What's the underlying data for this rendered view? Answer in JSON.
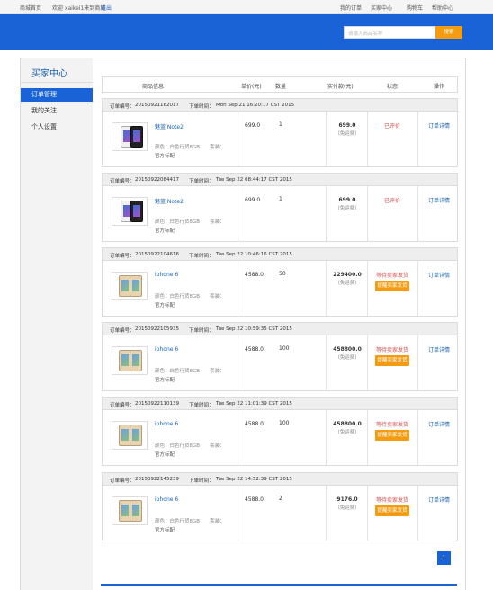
{
  "topbar": {
    "home": "商城首页",
    "welcome": "欢迎 xaikei1来到商城",
    "logout": "退出",
    "my_orders": "我的订单",
    "buyer_center": "买家中心",
    "cart": "购物车",
    "help": "帮助中心"
  },
  "search": {
    "placeholder": "请输入商品名称",
    "button": "搜索"
  },
  "sidebar": {
    "title": "买家中心",
    "items": [
      {
        "label": "订单管理"
      },
      {
        "label": "我的关注"
      },
      {
        "label": "个人设置"
      }
    ]
  },
  "table": {
    "headers": [
      "商品信息",
      "单价(元)",
      "数量",
      "实付款(元)",
      "状态",
      "操作"
    ]
  },
  "orders": [
    {
      "no_label": "订单编号：",
      "no": "20150921162017",
      "time_label": "下单时间：",
      "time": "Mon Sep 21 16:20:17 CST 2015",
      "product": "魅蓝 Note2",
      "attr": "颜色：白色行货8GB　　套装：",
      "attr2": "官方标配",
      "price": "699.0",
      "qty": "1",
      "paid": "699.0",
      "ship": "（免运费）",
      "status": "已评价",
      "remind": "",
      "detail": "订单详情",
      "img": "meilan-white"
    },
    {
      "no_label": "订单编号：",
      "no": "20150922084417",
      "time_label": "下单时间：",
      "time": "Tue Sep 22 08:44:17 CST 2015",
      "product": "魅蓝 Note2",
      "attr": "颜色：白色行货8GB　　套装：",
      "attr2": "官方标配",
      "price": "699.0",
      "qty": "1",
      "paid": "699.0",
      "ship": "（免运费）",
      "status": "已评价",
      "remind": "",
      "detail": "订单详情",
      "img": "meilan-white"
    },
    {
      "no_label": "订单编号：",
      "no": "20150922104616",
      "time_label": "下单时间：",
      "time": "Tue Sep 22 10:46:16 CST 2015",
      "product": "iphone 6",
      "attr": "颜色：白色行货8GB　　套装：",
      "attr2": "官方标配",
      "price": "4588.0",
      "qty": "50",
      "paid": "229400.0",
      "ship": "（免运费）",
      "status": "等待卖家发货",
      "remind": "提醒卖家发货",
      "detail": "订单详情",
      "img": "iphone-gold"
    },
    {
      "no_label": "订单编号：",
      "no": "20150922105935",
      "time_label": "下单时间：",
      "time": "Tue Sep 22 10:59:35 CST 2015",
      "product": "iphone 6",
      "attr": "颜色：白色行货8GB　　套装：",
      "attr2": "官方标配",
      "price": "4588.0",
      "qty": "100",
      "paid": "458800.0",
      "ship": "（免运费）",
      "status": "等待卖家发货",
      "remind": "提醒卖家发货",
      "detail": "订单详情",
      "img": "iphone-gold"
    },
    {
      "no_label": "订单编号：",
      "no": "20150922110139",
      "time_label": "下单时间：",
      "time": "Tue Sep 22 11:01:39 CST 2015",
      "product": "iphone 6",
      "attr": "颜色：白色行货8GB　　套装：",
      "attr2": "官方标配",
      "price": "4588.0",
      "qty": "100",
      "paid": "458800.0",
      "ship": "（免运费）",
      "status": "等待卖家发货",
      "remind": "提醒卖家发货",
      "detail": "订单详情",
      "img": "iphone-gold"
    },
    {
      "no_label": "订单编号：",
      "no": "20150922145239",
      "time_label": "下单时间：",
      "time": "Tue Sep 22 14:52:39 CST 2015",
      "product": "iphone 6",
      "attr": "颜色：白色行货8GB　　套装：",
      "attr2": "官方标配",
      "price": "4588.0",
      "qty": "2",
      "paid": "9176.0",
      "ship": "（免运费）",
      "status": "等待卖家发货",
      "remind": "提醒卖家发货",
      "detail": "订单详情",
      "img": "iphone-gold"
    }
  ],
  "pagination": {
    "current": "1"
  },
  "colors": {
    "brand_blue": "#1a63d6",
    "accent_orange": "#f39c12",
    "status_red": "#d9534f"
  }
}
